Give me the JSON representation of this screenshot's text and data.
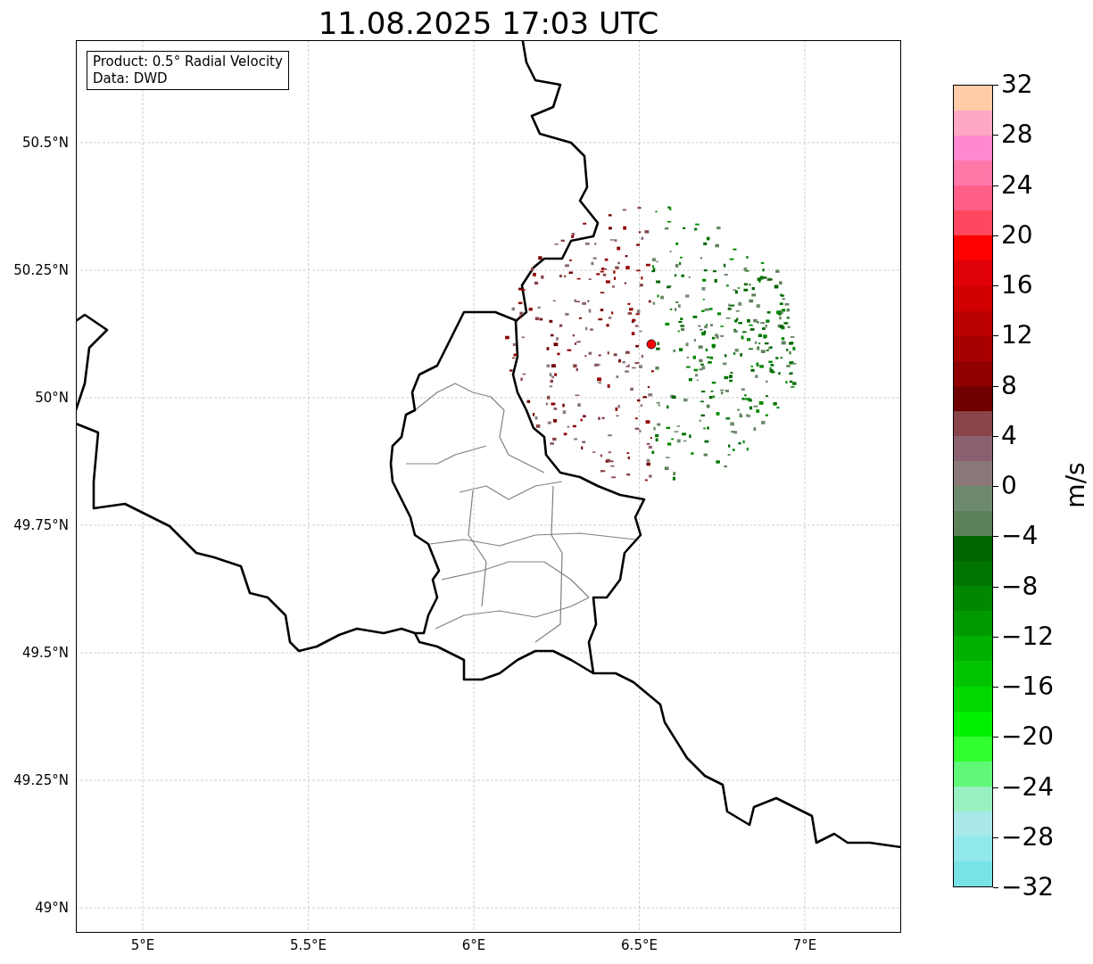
{
  "title": "11.08.2025 17:03 UTC",
  "info_box": [
    "Product: 0.5° Radial Velocity",
    "Data: DWD"
  ],
  "y_ticks": [
    "50.5°N",
    "50.25°N",
    "50°N",
    "49.75°N",
    "49.5°N",
    "49.25°N",
    "49°N"
  ],
  "x_ticks": [
    "5°E",
    "5.5°E",
    "6°E",
    "6.5°E",
    "7°E"
  ],
  "colorbar": {
    "label": "m/s",
    "ticks": [
      "32",
      "28",
      "24",
      "20",
      "16",
      "12",
      "8",
      "4",
      "0",
      "−4",
      "−8",
      "−12",
      "−16",
      "−20",
      "−24",
      "−28",
      "−32"
    ],
    "segments": [
      {
        "color": "#ffcba8"
      },
      {
        "color": "#ffa8c4"
      },
      {
        "color": "#ff88d0"
      },
      {
        "color": "#ff78a8"
      },
      {
        "color": "#ff5e88"
      },
      {
        "color": "#ff4860"
      },
      {
        "color": "#ff0000"
      },
      {
        "color": "#e00008"
      },
      {
        "color": "#d00000"
      },
      {
        "color": "#bb0000"
      },
      {
        "color": "#a80000"
      },
      {
        "color": "#900000"
      },
      {
        "color": "#700000"
      },
      {
        "color": "#884448"
      },
      {
        "color": "#8a6070"
      },
      {
        "color": "#8a7878"
      },
      {
        "color": "#6e8a6e"
      },
      {
        "color": "#5c8058"
      },
      {
        "color": "#006400"
      },
      {
        "color": "#007400"
      },
      {
        "color": "#008800"
      },
      {
        "color": "#009a00"
      },
      {
        "color": "#00b000"
      },
      {
        "color": "#00c400"
      },
      {
        "color": "#00d800"
      },
      {
        "color": "#00f000"
      },
      {
        "color": "#30ff30"
      },
      {
        "color": "#60f878"
      },
      {
        "color": "#98f0c0"
      },
      {
        "color": "#a8e8e8"
      },
      {
        "color": "#90e8ea"
      },
      {
        "color": "#78e2e6"
      }
    ]
  }
}
